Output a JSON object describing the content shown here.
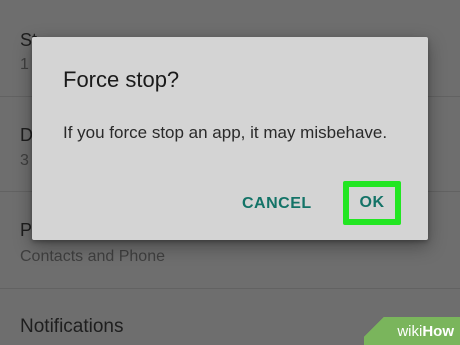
{
  "settings": {
    "rows": [
      {
        "title": "St",
        "subtitle": "1"
      },
      {
        "title": "D",
        "subtitle": "3"
      },
      {
        "title": "P",
        "subtitle": "Contacts and Phone"
      },
      {
        "title": "Notifications"
      }
    ]
  },
  "dialog": {
    "title": "Force stop?",
    "message": "If you force stop an app, it may misbehave.",
    "cancel_label": "CANCEL",
    "ok_label": "OK"
  },
  "watermark": {
    "wiki": "wiki",
    "how": "How"
  },
  "colors": {
    "dialog_bg": "#d4d4d4",
    "button_text": "#137367",
    "highlight": "#22e622",
    "watermark_bg": "#7ab55c"
  }
}
